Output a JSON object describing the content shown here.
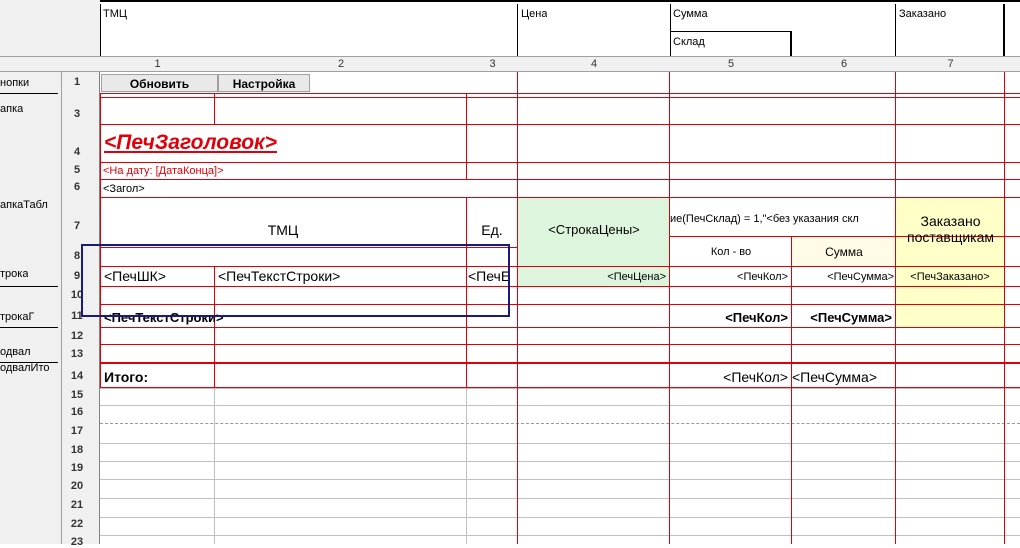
{
  "groups": {
    "tmc": "ТМЦ",
    "price": "Цена",
    "sum": "Сумма",
    "warehouse": "Склад",
    "ordered": "Заказано"
  },
  "column_numbers": [
    "1",
    "2",
    "3",
    "4",
    "5",
    "6",
    "7"
  ],
  "row_numbers": [
    "1",
    "3",
    "4",
    "5",
    "6",
    "7",
    "8",
    "9",
    "10",
    "11",
    "12",
    "13",
    "14",
    "15",
    "16",
    "17",
    "18",
    "19",
    "20",
    "21",
    "22",
    "23"
  ],
  "sections": {
    "knopki": "нопки",
    "shapka": "апка",
    "shapka_tabl": "апкаТабл",
    "stroka": "трока",
    "stroka_g": "трокаГ",
    "podval": "одвал",
    "podval_itog": "одвалИто"
  },
  "buttons": {
    "refresh": "Обновить",
    "settings": "Настройка"
  },
  "cells": {
    "title": "<ПечЗаголовок>",
    "date_line": "<На дату: [ДатаКонца]>",
    "zagol": "<Загол>",
    "tmc_header": "ТМЦ",
    "unit_header": "Ед.",
    "price_row_header": "<СтрокаЦены>",
    "warehouse_formula": "ие(ПечСклад) = 1,\"<без указания скл",
    "qty_header": "Кол - во",
    "sum_header": "Сумма",
    "ordered_header": "Заказано поставщикам",
    "barcode": "<ПечШК>",
    "item_text": "<ПечТекстСтроки>",
    "unit_value": "<ПечЕ",
    "price_value": "<ПечЦена>",
    "qty_value": "<ПечКол>",
    "sum_value": "<ПечСумма>",
    "ordered_value": "<ПечЗаказано>",
    "group_text": "<ПечТекстСтроки>",
    "group_qty": "<ПечКол>",
    "group_sum": "<ПечСумма>",
    "total_label": "Итого:",
    "total_qty": "<ПечКол>",
    "total_sum": "<ПечСумма>"
  },
  "colors": {
    "grid_red": "#e0000a",
    "title_red": "#e0000a",
    "price_green": "#dcf5dc",
    "ordered_yellow": "#ffffc8",
    "selection": "#1a1a7a"
  }
}
